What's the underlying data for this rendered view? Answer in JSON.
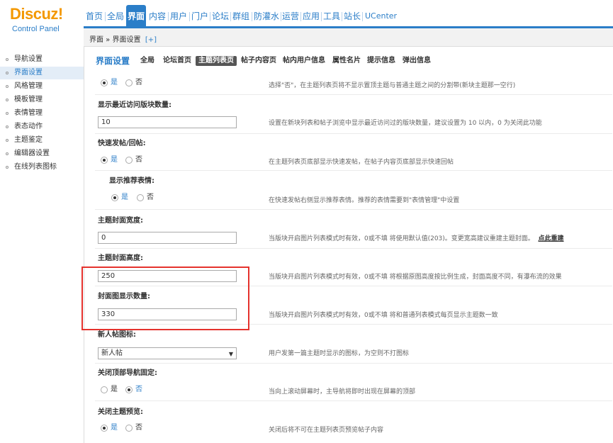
{
  "logo": {
    "main": "Discuz!",
    "sub": "Control Panel"
  },
  "nav": [
    {
      "label": "首页",
      "active": false
    },
    {
      "label": "全局",
      "active": false
    },
    {
      "label": "界面",
      "active": true
    },
    {
      "label": "内容",
      "active": false
    },
    {
      "label": "用户",
      "active": false
    },
    {
      "label": "门户",
      "active": false
    },
    {
      "label": "论坛",
      "active": false
    },
    {
      "label": "群组",
      "active": false
    },
    {
      "label": "防灌水",
      "active": false
    },
    {
      "label": "运营",
      "active": false
    },
    {
      "label": "应用",
      "active": false
    },
    {
      "label": "工具",
      "active": false
    },
    {
      "label": "站长",
      "active": false
    },
    {
      "label": "UCenter",
      "active": false
    }
  ],
  "breadcrumb": {
    "text": "界面 » 界面设置",
    "plus": "[+]"
  },
  "sidebar": [
    {
      "label": "导航设置",
      "active": false
    },
    {
      "label": "界面设置",
      "active": true
    },
    {
      "label": "风格管理",
      "active": false
    },
    {
      "label": "模板管理",
      "active": false
    },
    {
      "label": "表情管理",
      "active": false
    },
    {
      "label": "表态动作",
      "active": false
    },
    {
      "label": "主题鉴定",
      "active": false
    },
    {
      "label": "编辑器设置",
      "active": false
    },
    {
      "label": "在线列表图标",
      "active": false
    }
  ],
  "tabs": {
    "title": "界面设置",
    "items": [
      {
        "label": "全局",
        "active": false
      },
      {
        "label": "论坛首页",
        "active": false
      },
      {
        "label": "主题列表页",
        "active": true
      },
      {
        "label": "帖子内容页",
        "active": false
      },
      {
        "label": "帖内用户信息",
        "active": false
      },
      {
        "label": "属性名片",
        "active": false
      },
      {
        "label": "提示信息",
        "active": false
      },
      {
        "label": "弹出信息",
        "active": false
      }
    ]
  },
  "radio_labels": {
    "yes": "是",
    "no": "否"
  },
  "settings": {
    "separator": {
      "value": "yes",
      "desc": "选择\"否\"，在主题列表页将不显示置顶主题与普通主题之间的分割带(新块主题那一空行)"
    },
    "recent_forums": {
      "label": "显示最近访问版块数量:",
      "value": "10",
      "desc": "设置在新块列表和帖子浏览中显示最近访问过的版块数量，建议设置为 10 以内，0 为关闭此功能"
    },
    "fast_post": {
      "label": "快速发帖/回帖:",
      "value": "yes",
      "desc": "在主题列表页底部显示快速发帖，在帖子内容页底部显示快速回帖"
    },
    "smilies": {
      "label": "显示推荐表情:",
      "value": "yes",
      "desc": "在快速发帖右侧显示推荐表情。推荐的表情需要到\"表情管理\"中设置"
    },
    "cover_width": {
      "label": "主题封面宽度:",
      "value": "0",
      "desc": "当版块开启图片列表模式时有效，0或不填 将使用默认值(203)。变更宽高建议重建主题封面。",
      "link": "点此重建"
    },
    "cover_height": {
      "label": "主题封面高度:",
      "value": "250",
      "desc": "当版块开启图片列表模式时有效，0或不填 将根据原图高度按比例生成，封面高度不同，有瀑布流的效果"
    },
    "cover_count": {
      "label": "封面图显示数量:",
      "value": "330",
      "desc": "当版块开启图片列表模式时有效，0或不填 将和普通列表模式每页显示主题数一致"
    },
    "new_icon": {
      "label": "新人帖图标:",
      "value": "新人帖",
      "desc": "用户发第一篇主题时显示的图标，为空则不打图标"
    },
    "fixed_nav": {
      "label": "关闭顶部导航固定:",
      "value": "no",
      "desc": "当向上滚动屏幕时，主导航将即时出现在屏幕的顶部"
    },
    "preview": {
      "label": "关闭主题预览:",
      "value": "yes",
      "desc": "关闭后将不可在主题列表页预览帖子内容"
    }
  },
  "colors": {
    "accent": "#2b7ec8",
    "logo": "#f39800",
    "highlight": "#e5322d"
  }
}
